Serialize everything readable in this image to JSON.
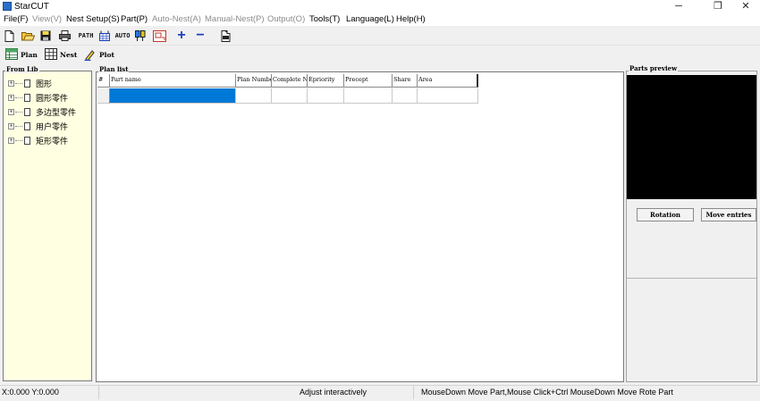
{
  "window": {
    "title": "StarCUT",
    "minimize_glyph": "─",
    "restore_glyph": "❐",
    "close_glyph": "✕"
  },
  "menu": [
    {
      "label": "File(F)",
      "enabled": true
    },
    {
      "label": "View(V)",
      "enabled": false
    },
    {
      "label": "Nest Setup(S)",
      "enabled": true
    },
    {
      "label": "Part(P)",
      "enabled": true
    },
    {
      "label": "Auto-Nest(A)",
      "enabled": false
    },
    {
      "label": "Manual-Nest(P)",
      "enabled": false
    },
    {
      "label": "Output(O)",
      "enabled": false
    },
    {
      "label": "Tools(T)",
      "enabled": true
    },
    {
      "label": "Language(L)",
      "enabled": true
    },
    {
      "label": "Help(H)",
      "enabled": true
    }
  ],
  "toolbar": {
    "icons": [
      "new-icon",
      "open-icon",
      "save-icon",
      "print-icon",
      "path-icon",
      "sheet-icon",
      "auto-icon",
      "parts-icon",
      "nest-region-icon",
      "add-icon",
      "remove-icon",
      "export-icon"
    ],
    "path_label": "PATH",
    "auto_label": "AUTO",
    "plus_glyph": "+",
    "minus_glyph": "−",
    "accent_color": "#1f3fbf"
  },
  "modes": {
    "plan_label": "Plan",
    "nest_label": "Nest",
    "plot_label": "Plot"
  },
  "from_lib": {
    "title": "From Lib",
    "items": [
      "图形",
      "圆形零件",
      "多边型零件",
      "用户零件",
      "矩形零件"
    ],
    "background": "#ffffe1"
  },
  "plan_list": {
    "title": "Plan list",
    "columns": [
      "#",
      "Part name",
      "Plan Number",
      "Complete N",
      "Epriority",
      "Precept",
      "Share",
      "Area"
    ],
    "selection_color": "#0078d7"
  },
  "parts_preview": {
    "title": "Parts preview",
    "rotation_label": "Rotation",
    "move_entries_label": "Move entries"
  },
  "status": {
    "coords": "X:0.000 Y:0.000",
    "mode": "Adjust interactively",
    "hint": "MouseDown Move Part,Mouse Click+Ctrl MouseDown Move Rote Part"
  }
}
